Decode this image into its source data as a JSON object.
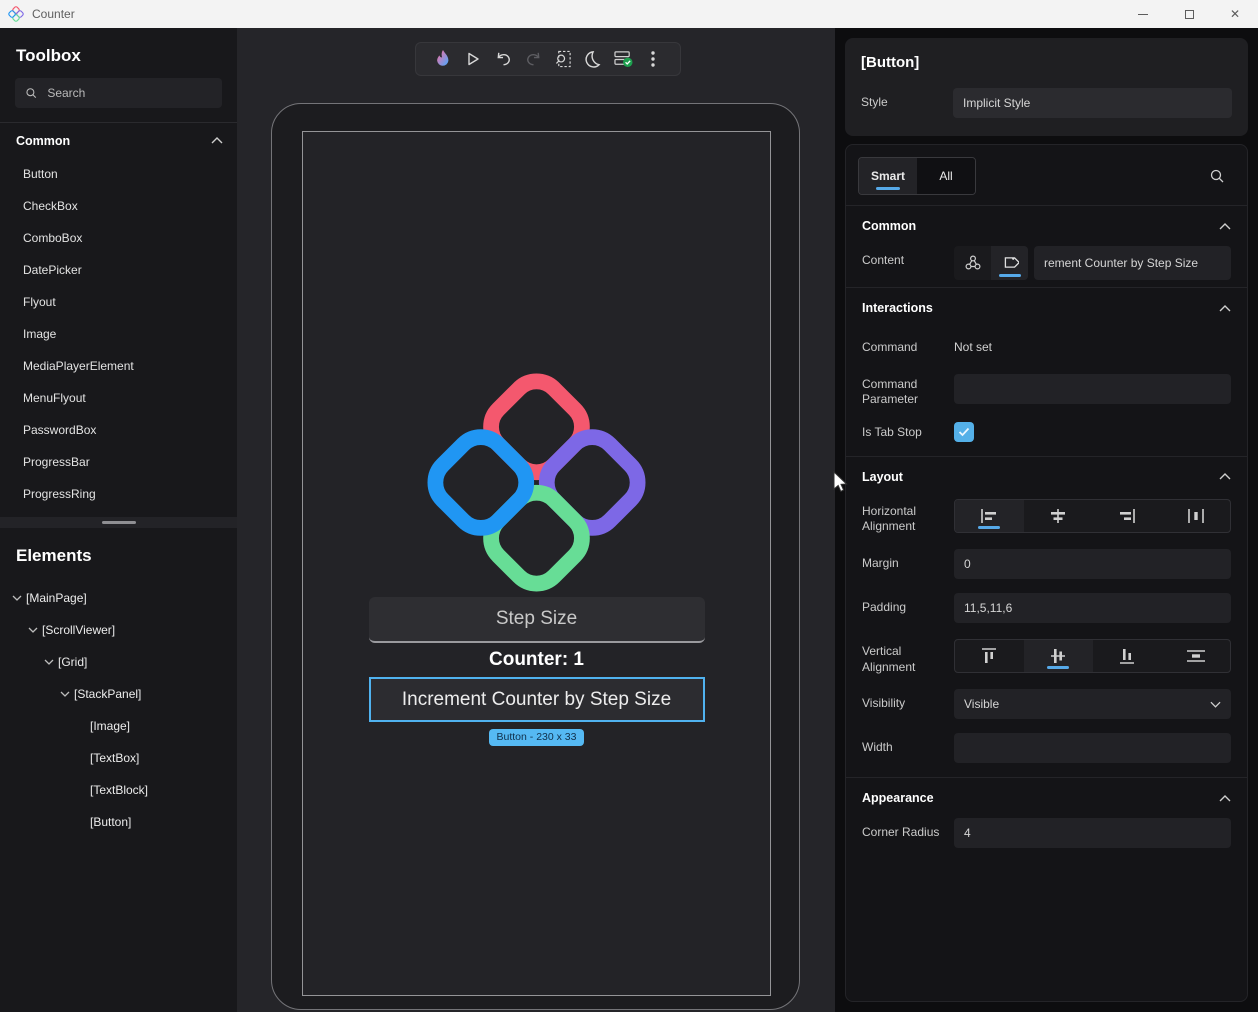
{
  "titlebar": {
    "title": "Counter"
  },
  "toolbox": {
    "title": "Toolbox",
    "search_placeholder": "Search",
    "category": "Common",
    "items": [
      "Button",
      "CheckBox",
      "ComboBox",
      "DatePicker",
      "Flyout",
      "Image",
      "MediaPlayerElement",
      "MenuFlyout",
      "PasswordBox",
      "ProgressBar",
      "ProgressRing"
    ]
  },
  "elements": {
    "title": "Elements",
    "tree": [
      {
        "label": "[MainPage]",
        "depth": 0,
        "expandable": true
      },
      {
        "label": "[ScrollViewer]",
        "depth": 1,
        "expandable": true
      },
      {
        "label": "[Grid]",
        "depth": 2,
        "expandable": true
      },
      {
        "label": "[StackPanel]",
        "depth": 3,
        "expandable": true
      },
      {
        "label": "[Image]",
        "depth": 4,
        "expandable": false
      },
      {
        "label": "[TextBox]",
        "depth": 4,
        "expandable": false
      },
      {
        "label": "[TextBlock]",
        "depth": 4,
        "expandable": false
      },
      {
        "label": "[Button]",
        "depth": 4,
        "expandable": false
      }
    ]
  },
  "canvas": {
    "toolbar_icons": [
      "hot-design-flame",
      "play",
      "undo",
      "redo",
      "inspect-zoom",
      "dark-mode-moon",
      "validate-check",
      "more-kebab"
    ],
    "textbox_placeholder": "Step Size",
    "counter_text": "Counter: 1",
    "button_label": "Increment Counter by Step Size",
    "selection_badge": "Button - 230 x 33"
  },
  "inspector": {
    "header": {
      "title": "[Button]",
      "style_label": "Style",
      "style_value": "Implicit Style"
    },
    "tabs": {
      "smart": "Smart",
      "all": "All"
    },
    "common": {
      "title": "Common",
      "content_label": "Content",
      "content_value": "rement Counter by Step Size"
    },
    "interactions": {
      "title": "Interactions",
      "command_label": "Command",
      "command_value": "Not set",
      "command_parameter_label": "Command Parameter",
      "is_tab_stop_label": "Is Tab Stop",
      "is_tab_stop_checked": true
    },
    "layout": {
      "title": "Layout",
      "horizontal_alignment_label": "Horizontal Alignment",
      "horizontal_alignment_selected": "left",
      "margin_label": "Margin",
      "margin_value": "0",
      "padding_label": "Padding",
      "padding_value": "11,5,11,6",
      "vertical_alignment_label": "Vertical Alignment",
      "vertical_alignment_selected": "center",
      "visibility_label": "Visibility",
      "visibility_value": "Visible",
      "width_label": "Width",
      "width_value": ""
    },
    "appearance": {
      "title": "Appearance",
      "corner_radius_label": "Corner Radius",
      "corner_radius_value": "4"
    }
  },
  "colors": {
    "accent_blue": "#56a9e8",
    "badge_blue": "#55b9f3",
    "selection_outline": "#50b2ef",
    "logo_red": "#f4586e",
    "logo_blue": "#2096f3",
    "logo_purple": "#7d68e6",
    "logo_green": "#67dd96",
    "check_green": "#1d9f4e"
  }
}
